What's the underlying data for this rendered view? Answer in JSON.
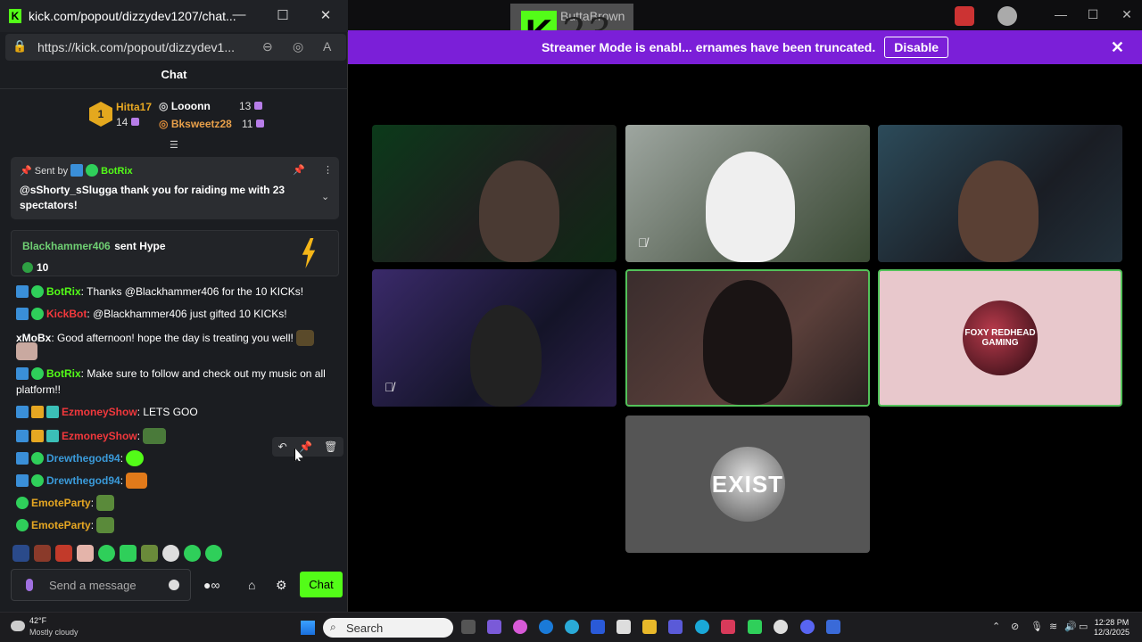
{
  "popout": {
    "title": "kick.com/popout/dizzydev1207/chat...",
    "url": "https://kick.com/popout/dizzydev1...",
    "chat_header": "Chat"
  },
  "leaderboard": [
    {
      "rank": "1",
      "name": "Hitta17",
      "count": "14"
    },
    {
      "name": "Looonn",
      "count": "13"
    },
    {
      "name": "Bksweetz28",
      "count": "11"
    }
  ],
  "pinned": {
    "sent_by_label": "Sent by",
    "sender": "BotRix",
    "message": "@sShorty_sSlugga thank you for raiding me with 23 spectators!"
  },
  "hype": {
    "user": "Blackhammer406",
    "text": "sent Hype",
    "amount": "10"
  },
  "messages": [
    {
      "user": "BotRix",
      "text": ": Thanks @Blackhammer406 for the 10 KICKs!"
    },
    {
      "user": "KickBot",
      "text": ": @Blackhammer406 just gifted 10 KICKs!"
    },
    {
      "user": "xMoBx",
      "text": ": Good afternoon! hope the day is treating you well!"
    },
    {
      "user": "BotRix",
      "text": ": Make sure to follow and check out my music on all"
    },
    {
      "text": "platform!!"
    },
    {
      "user": "EzmoneyShow",
      "text": ": LETS GOO"
    },
    {
      "user": "EzmoneyShow",
      "text": ":"
    },
    {
      "user": "Drewthegod94",
      "text": ":"
    },
    {
      "user": "Drewthegod94",
      "text": ":"
    },
    {
      "user": "EmoteParty",
      "text": ":"
    },
    {
      "user": "EmoteParty",
      "text": ":"
    }
  ],
  "input": {
    "placeholder": "Send a message",
    "chat_button": "Chat"
  },
  "stream": {
    "window_title": "ButtaBrown",
    "k23_text": "23",
    "banner_text": "Streamer Mode is enabl... ernames have been truncated.",
    "disable_label": "Disable",
    "tiles": [
      {
        "logo_text": "FOXY REDHEAD GAMING"
      },
      {
        "logo_text": "EXIST"
      }
    ]
  },
  "taskbar": {
    "temp": "42°F",
    "weather": "Mostly cloudy",
    "search": "Search",
    "time": "12:28 PM",
    "date": "12/3/2025"
  },
  "colors": {
    "kick_green": "#53fc18",
    "banner_purple": "#7b1fd8",
    "tile_active_border": "#53c25a"
  }
}
